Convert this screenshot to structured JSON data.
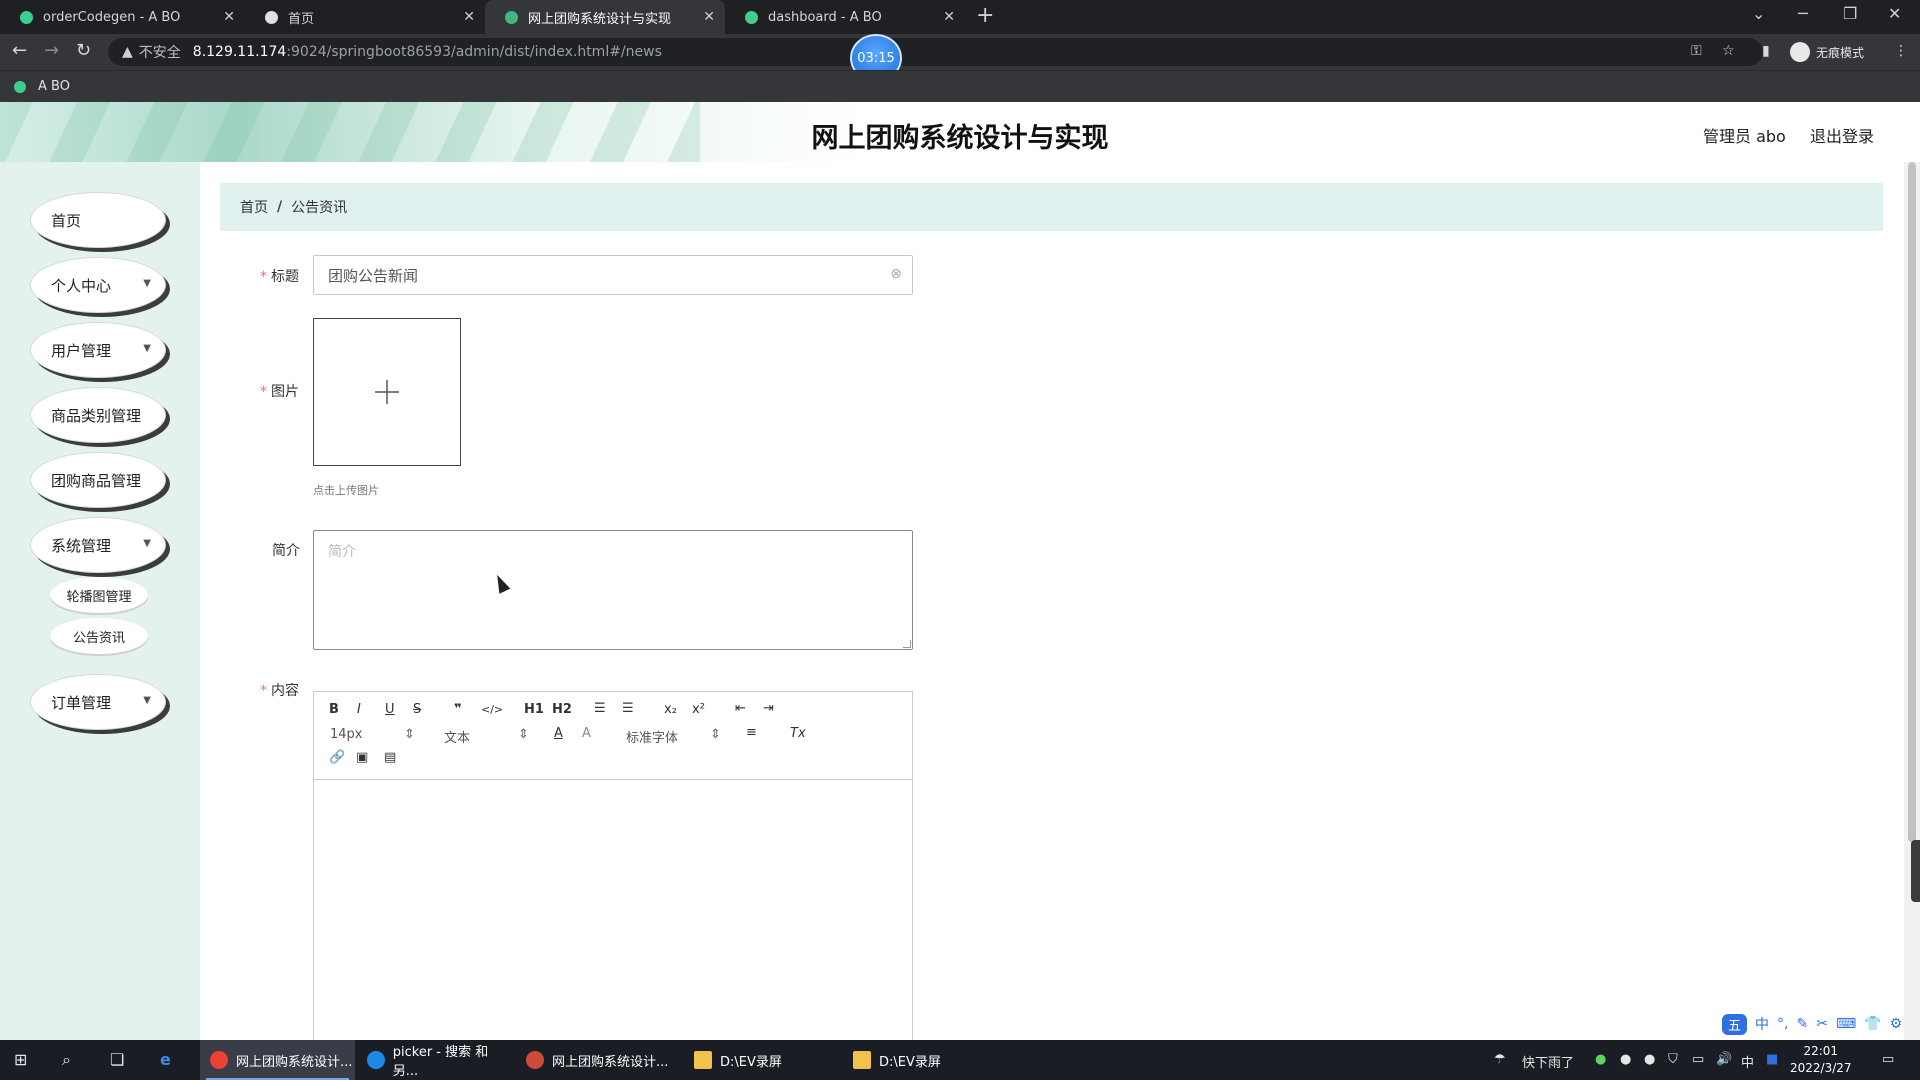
{
  "browser": {
    "tabs": [
      {
        "title": "orderCodegen - A BO",
        "favicon_color": "#3ecf8e"
      },
      {
        "title": "首页",
        "favicon_color": "#e0e0e0"
      },
      {
        "title": "网上团购系统设计与实现",
        "favicon_color": "#41b883"
      },
      {
        "title": "dashboard - A BO",
        "favicon_color": "#3ecf8e"
      }
    ],
    "new_tab_symbol": "+",
    "address": {
      "security_warning": "不安全",
      "url_host": "8.129.11.174",
      "url_rest": ":9024/springboot86593/admin/dist/index.html#/news"
    },
    "timer": "03:15",
    "incognito_label": "无痕模式",
    "bookmarks": [
      {
        "label": "A BO"
      }
    ]
  },
  "header": {
    "title": "网上团购系统设计与实现",
    "admin_label": "管理员 abo",
    "logout_label": "退出登录"
  },
  "sidebar": {
    "items": [
      {
        "label": "首页",
        "has_submenu": false
      },
      {
        "label": "个人中心",
        "has_submenu": true
      },
      {
        "label": "用户管理",
        "has_submenu": true
      },
      {
        "label": "商品类别管理",
        "has_submenu": false
      },
      {
        "label": "团购商品管理",
        "has_submenu": false
      },
      {
        "label": "系统管理",
        "has_submenu": true
      },
      {
        "label": "订单管理",
        "has_submenu": true
      }
    ],
    "subitems": [
      {
        "label": "轮播图管理"
      },
      {
        "label": "公告资讯"
      }
    ]
  },
  "breadcrumb": {
    "home": "首页",
    "separator": "/",
    "current": "公告资讯"
  },
  "form": {
    "title_label": "标题",
    "title_value": "团购公告新闻",
    "image_label": "图片",
    "image_hint": "点击上传图片",
    "summary_label": "简介",
    "summary_placeholder": "简介",
    "content_label": "内容",
    "required_mark": "*"
  },
  "editor": {
    "buttons": [
      "B",
      "I",
      "U",
      "S",
      "❞",
      "</>",
      "H1",
      "H2",
      "ordered-list",
      "bullet-list",
      "x₂",
      "x²",
      "outdent",
      "indent"
    ],
    "font_size": "14px",
    "header_select": "文本",
    "font_family": "标准字体",
    "color_icon": "A",
    "background_icon": "A",
    "align_icon": "align-left",
    "clear_icon": "Tx",
    "insert_buttons": [
      "link-icon",
      "image-icon",
      "video-icon"
    ]
  },
  "ime": {
    "mode": "中"
  },
  "taskbar": {
    "items": [
      {
        "label": "网上团购系统设计...",
        "active": true,
        "color": "#ea4335"
      },
      {
        "label": "picker - 搜索 和另...",
        "active": false,
        "color": "#1e88e5"
      },
      {
        "label": "网上团购系统设计...",
        "active": false,
        "color": "#d04a3a"
      },
      {
        "label": "D:\\EV录屏",
        "active": false,
        "color": "#f2c14e"
      },
      {
        "label": "D:\\EV录屏",
        "active": false,
        "color": "#f2c14e"
      }
    ],
    "weather": "快下雨了",
    "input_lang": "中",
    "time": "22:01",
    "date": "2022/3/27"
  }
}
